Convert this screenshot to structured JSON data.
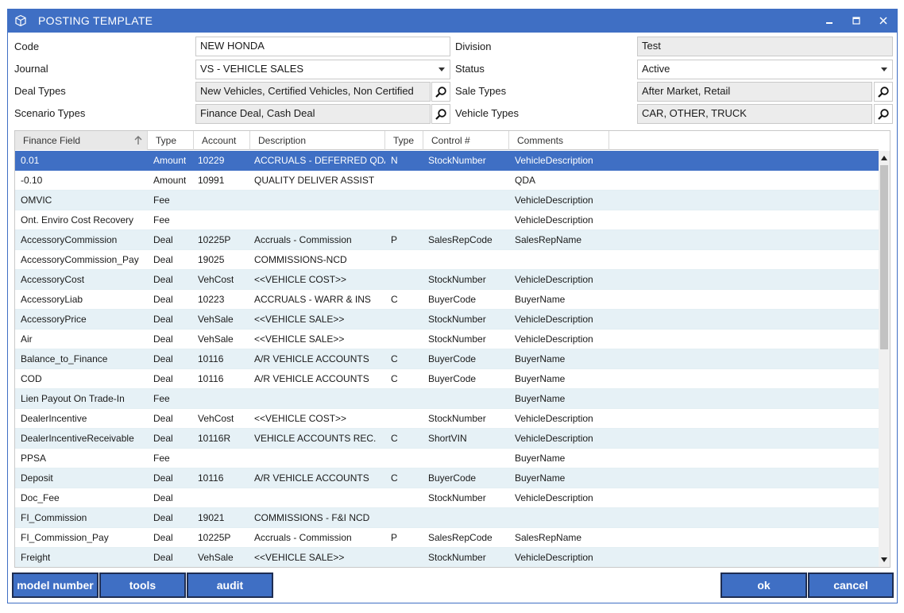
{
  "window": {
    "title": "POSTING TEMPLATE"
  },
  "form": {
    "code_label": "Code",
    "code_value": "NEW HONDA",
    "division_label": "Division",
    "division_value": "Test",
    "journal_label": "Journal",
    "journal_value": "VS -  VEHICLE SALES",
    "status_label": "Status",
    "status_value": "Active",
    "deal_types_label": "Deal Types",
    "deal_types_value": "New  Vehicles, Certified  Vehicles, Non  Certified",
    "sale_types_label": "Sale Types",
    "sale_types_value": "After Market, Retail",
    "scenario_types_label": "Scenario Types",
    "scenario_types_value": "Finance  Deal, Cash  Deal",
    "vehicle_types_label": "Vehicle Types",
    "vehicle_types_value": "CAR, OTHER, TRUCK"
  },
  "table": {
    "columns": [
      "Finance Field",
      "Type",
      "Account",
      "Description",
      "Type",
      "Control #",
      "Comments"
    ],
    "rows": [
      [
        "0.01",
        "Amount",
        "10229",
        "ACCRUALS - DEFERRED QDA",
        "N",
        "StockNumber",
        "VehicleDescription"
      ],
      [
        "-0.10",
        "Amount",
        "10991",
        "QUALITY DELIVER ASSIST",
        "",
        "",
        "QDA"
      ],
      [
        "OMVIC",
        "Fee",
        "",
        "",
        "",
        "",
        "VehicleDescription"
      ],
      [
        "Ont. Enviro Cost Recovery",
        "Fee",
        "",
        "",
        "",
        "",
        "VehicleDescription"
      ],
      [
        "AccessoryCommission",
        "Deal",
        "10225P",
        "Accruals - Commission",
        "P",
        "SalesRepCode",
        "SalesRepName"
      ],
      [
        "AccessoryCommission_Pay",
        "Deal",
        "19025",
        "COMMISSIONS-NCD",
        "",
        "",
        ""
      ],
      [
        "AccessoryCost",
        "Deal",
        "VehCost",
        "<<VEHICLE COST>>",
        "",
        "StockNumber",
        "VehicleDescription"
      ],
      [
        "AccessoryLiab",
        "Deal",
        "10223",
        "ACCRUALS - WARR & INS",
        "C",
        "BuyerCode",
        "BuyerName"
      ],
      [
        "AccessoryPrice",
        "Deal",
        "VehSale",
        "<<VEHICLE SALE>>",
        "",
        "StockNumber",
        "VehicleDescription"
      ],
      [
        "Air",
        "Deal",
        "VehSale",
        "<<VEHICLE SALE>>",
        "",
        "StockNumber",
        "VehicleDescription"
      ],
      [
        "Balance_to_Finance",
        "Deal",
        "10116",
        "A/R VEHICLE ACCOUNTS",
        "C",
        "BuyerCode",
        "BuyerName"
      ],
      [
        "COD",
        "Deal",
        "10116",
        "A/R VEHICLE ACCOUNTS",
        "C",
        "BuyerCode",
        "BuyerName"
      ],
      [
        "Lien Payout On Trade-In",
        "Fee",
        "",
        "",
        "",
        "",
        "BuyerName"
      ],
      [
        "DealerIncentive",
        "Deal",
        "VehCost",
        "<<VEHICLE COST>>",
        "",
        "StockNumber",
        "VehicleDescription"
      ],
      [
        "DealerIncentiveReceivable",
        "Deal",
        "10116R",
        "VEHICLE ACCOUNTS REC.",
        "C",
        "ShortVIN",
        "VehicleDescription"
      ],
      [
        "PPSA",
        "Fee",
        "",
        "",
        "",
        "",
        "BuyerName"
      ],
      [
        "Deposit",
        "Deal",
        "10116",
        "A/R VEHICLE ACCOUNTS",
        "C",
        "BuyerCode",
        "BuyerName"
      ],
      [
        "Doc_Fee",
        "Deal",
        "",
        "",
        "",
        "StockNumber",
        "VehicleDescription"
      ],
      [
        "FI_Commission",
        "Deal",
        "19021",
        "COMMISSIONS - F&I NCD",
        "",
        "",
        ""
      ],
      [
        "FI_Commission_Pay",
        "Deal",
        "10225P",
        "Accruals - Commission",
        "P",
        "SalesRepCode",
        "SalesRepName"
      ],
      [
        "Freight",
        "Deal",
        "VehSale",
        "<<VEHICLE SALE>>",
        "",
        "StockNumber",
        "VehicleDescription"
      ]
    ]
  },
  "buttons": {
    "model_number": "model number",
    "tools": "tools",
    "audit": "audit",
    "ok": "ok",
    "cancel": "cancel"
  },
  "colors": {
    "accent": "#3f6fc4",
    "row_alt": "#e6f1f6",
    "button_border": "#1e2d52"
  }
}
